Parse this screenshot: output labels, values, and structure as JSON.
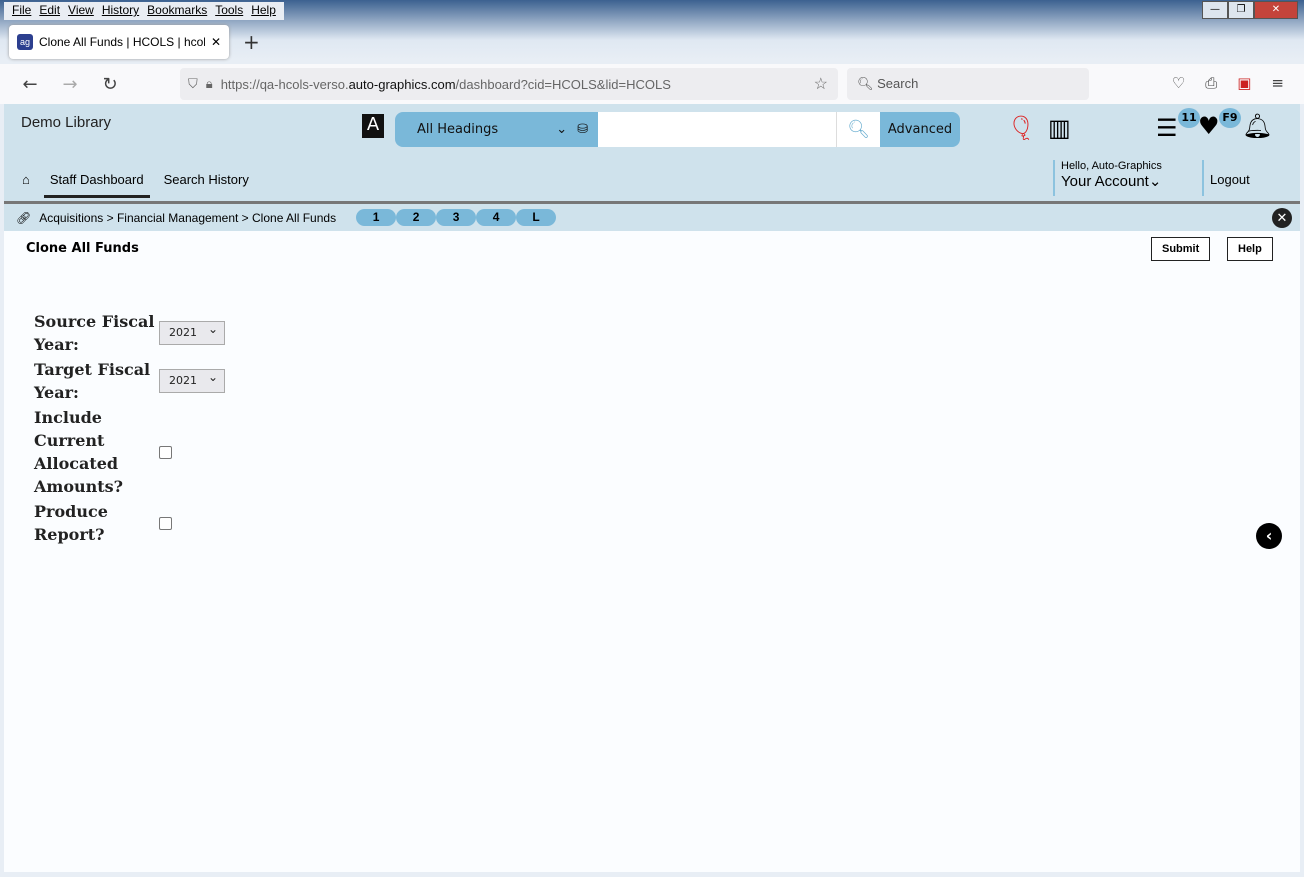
{
  "browser": {
    "menu": [
      "File",
      "Edit",
      "View",
      "History",
      "Bookmarks",
      "Tools",
      "Help"
    ],
    "tab_title": "Clone All Funds | HCOLS | hcols",
    "url_prefix": "https://qa-hcols-verso.",
    "url_domain": "auto-graphics.com",
    "url_suffix": "/dashboard?cid=HCOLS&lid=HCOLS",
    "search_placeholder": "Search"
  },
  "header": {
    "library": "Demo Library",
    "search_scope": "All Headings",
    "advanced": "Advanced",
    "list_badge": "11",
    "fav_badge": "F9",
    "nav": [
      "Staff Dashboard",
      "Search History"
    ],
    "greeting": "Hello, Auto-Graphics",
    "account": "Your Account",
    "logout": "Logout"
  },
  "breadcrumb": {
    "text": "Acquisitions > Financial Management > Clone All Funds",
    "pills": [
      "1",
      "2",
      "3",
      "4",
      "L"
    ]
  },
  "page": {
    "title": "Clone All Funds",
    "submit": "Submit",
    "help": "Help",
    "fields": {
      "source_label": "Source Fiscal Year:",
      "source_value": "2021",
      "target_label": "Target Fiscal Year:",
      "target_value": "2021",
      "include_label": "Include Current Allocated Amounts?",
      "include_checked": false,
      "report_label": "Produce Report?",
      "report_checked": false
    }
  }
}
